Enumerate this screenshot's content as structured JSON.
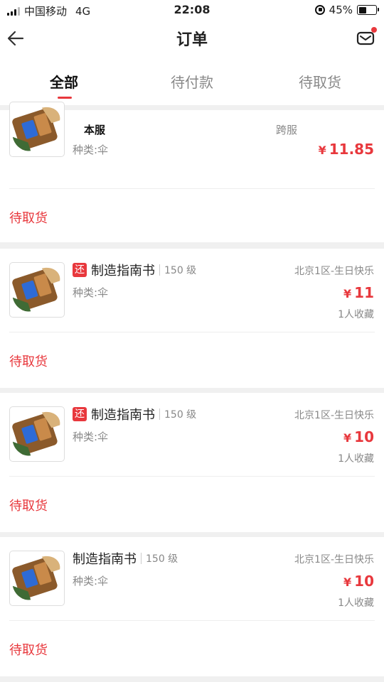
{
  "status_bar": {
    "carrier": "中国移动",
    "network": "4G",
    "time": "22:08",
    "battery": "45%",
    "battery_level": 0.45
  },
  "nav": {
    "title": "订单",
    "back_icon": "back-arrow-icon",
    "message_icon": "mail-icon"
  },
  "tabs": [
    {
      "label": "全部",
      "active": true
    },
    {
      "label": "待付款",
      "active": false
    },
    {
      "label": "待取货",
      "active": false
    }
  ],
  "filter_tip": {
    "local": "本服",
    "cross": "跨服"
  },
  "orders": [
    {
      "kind": "种类:伞",
      "price_symbol": "¥",
      "price": "11.85",
      "status": "待取货"
    },
    {
      "badge": "还",
      "name": "制造指南书",
      "level": "150 级",
      "kind": "种类:伞",
      "server": "北京1区-生日快乐",
      "price_symbol": "¥",
      "price": "11",
      "favorites": "1人收藏",
      "status": "待取货"
    },
    {
      "badge": "还",
      "name": "制造指南书",
      "level": "150 级",
      "kind": "种类:伞",
      "server": "北京1区-生日快乐",
      "price_symbol": "¥",
      "price": "10",
      "favorites": "1人收藏",
      "status": "待取货"
    },
    {
      "name": "制造指南书",
      "level": "150 级",
      "kind": "种类:伞",
      "server": "北京1区-生日快乐",
      "price_symbol": "¥",
      "price": "10",
      "favorites": "1人收藏",
      "status": "待取货"
    }
  ],
  "colors": {
    "accent": "#e8383d",
    "muted": "#888888",
    "background": "#f0f0f0"
  }
}
